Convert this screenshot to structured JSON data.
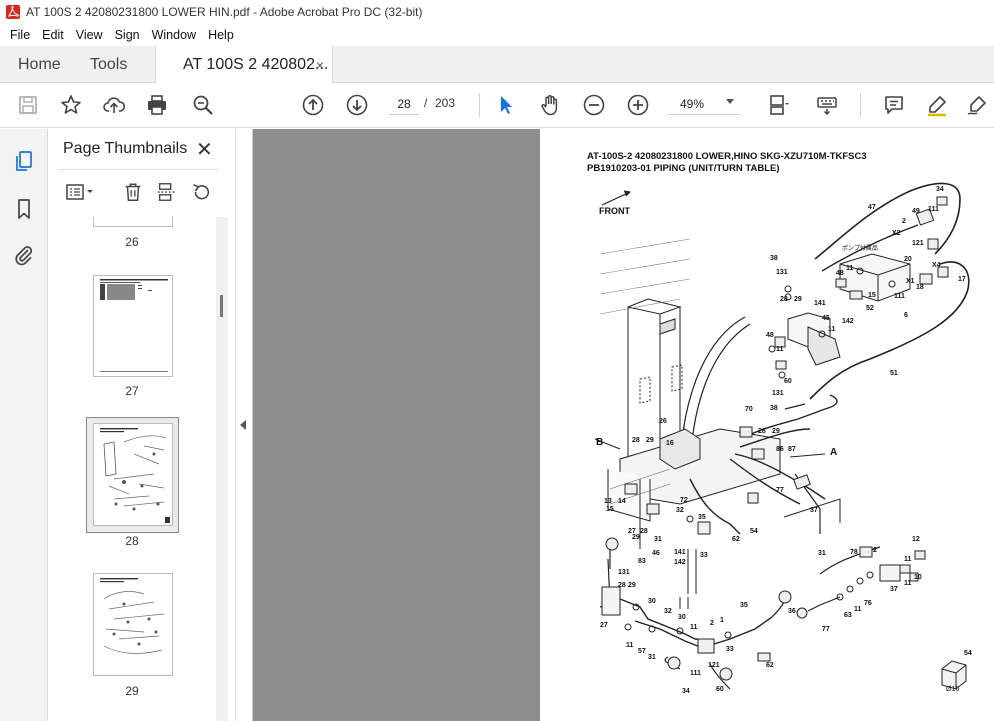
{
  "window": {
    "title": "AT 100S 2 42080231800 LOWER HIN.pdf - Adobe Acrobat Pro DC (32-bit)"
  },
  "menu": [
    "File",
    "Edit",
    "View",
    "Sign",
    "Window",
    "Help"
  ],
  "tabs": {
    "home": "Home",
    "tools": "Tools",
    "document": "AT 100S 2 420802...",
    "close_glyph": "×"
  },
  "toolbar": {
    "current_page": "28",
    "page_separator": "/",
    "total_pages": "203",
    "zoom": "49%"
  },
  "thumbnail_panel": {
    "title": "Page Thumbnails",
    "close_glyph": "✕",
    "thumbnails": [
      {
        "label": "26"
      },
      {
        "label": "27"
      },
      {
        "label": "28",
        "selected": true
      },
      {
        "label": "29"
      }
    ]
  },
  "document": {
    "heading_line1": "AT-100S-2 42080231800 LOWER,HINO SKG-XZU710M-TKFSC3",
    "heading_line2": "PB1910203-01 PIPING (UNIT/TURN TABLE)",
    "front_label": "FRONT",
    "label_a": "A",
    "label_b": "B",
    "japanese_label": "ポンプ付属品",
    "part_numbers_top": [
      "34",
      "47",
      "49",
      "111",
      "2",
      "X2",
      "121",
      "20",
      "38",
      "131",
      "48",
      "11",
      "X4",
      "X1",
      "111",
      "18",
      "17",
      "15",
      "52",
      "6",
      "28",
      "29",
      "141",
      "45",
      "11",
      "142",
      "48",
      "11",
      "60",
      "131",
      "38",
      "51"
    ],
    "part_numbers_mid": [
      "26",
      "70",
      "28",
      "29",
      "16",
      "86",
      "87",
      "28",
      "29",
      "72",
      "32",
      "35",
      "77",
      "54",
      "37",
      "62",
      "13",
      "14",
      "15",
      "27",
      "28",
      "29",
      "31",
      "46",
      "141",
      "142",
      "33"
    ],
    "part_numbers_bottom": [
      "83",
      "131",
      "28",
      "29",
      "30",
      "32",
      "30",
      "11",
      "2",
      "1",
      "35",
      "36",
      "27",
      "11",
      "57",
      "31",
      "33",
      "111",
      "121",
      "34",
      "60",
      "62",
      "31",
      "78",
      "2",
      "12",
      "11",
      "10",
      "37",
      "11",
      "76",
      "11",
      "63",
      "77",
      "54",
      "Ø16"
    ]
  },
  "colors": {
    "accent_blue": "#1473e6",
    "doc_gray": "#8e8e8e",
    "acrobat_red": "#d9291c"
  }
}
